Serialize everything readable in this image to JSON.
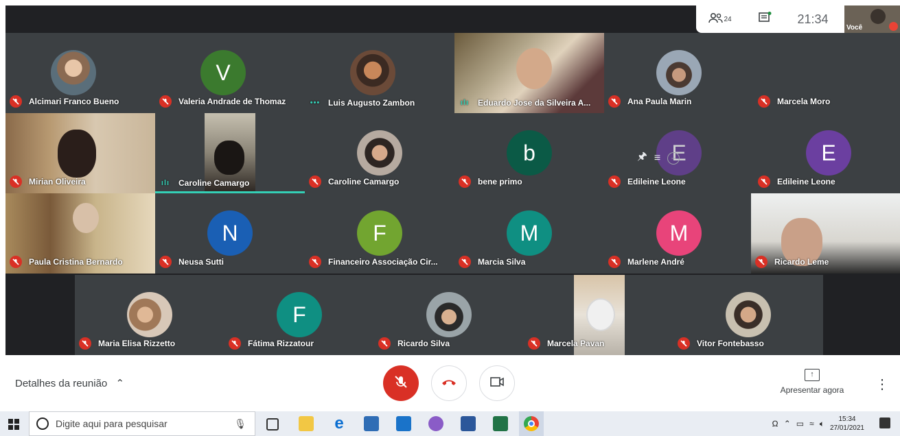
{
  "topbar": {
    "participants_count": "24",
    "time": "21:34",
    "self_label": "Você"
  },
  "row1": [
    {
      "name": "Alcimari Franco Bueno"
    },
    {
      "name": "Valeria Andrade de Thomaz",
      "initial": "V"
    },
    {
      "name": "Luis Augusto Zambon"
    },
    {
      "name": "Eduardo Jose da Silveira A..."
    },
    {
      "name": "Ana Paula Marin"
    },
    {
      "name": "Marcela Moro"
    }
  ],
  "row2": [
    {
      "name": "Mirian Oliveira"
    },
    {
      "name": "Caroline Camargo"
    },
    {
      "name": "Caroline Camargo"
    },
    {
      "name": "bene primo",
      "initial": "b"
    },
    {
      "name": "Edileine Leone",
      "initial": "E"
    },
    {
      "name": "Edileine Leone",
      "initial": "E"
    }
  ],
  "row3": [
    {
      "name": "Paula Cristina Bernardo"
    },
    {
      "name": "Neusa Sutti",
      "initial": "N"
    },
    {
      "name": "Financeiro Associação Cir...",
      "initial": "F"
    },
    {
      "name": "Marcia Silva",
      "initial": "M"
    },
    {
      "name": "Marlene André",
      "initial": "M"
    },
    {
      "name": "Ricardo Leme"
    }
  ],
  "row4": [
    {
      "name": "Maria Elisa Rizzetto"
    },
    {
      "name": "Fátima Rizzatour",
      "initial": "F"
    },
    {
      "name": "Ricardo Silva"
    },
    {
      "name": "Marcela Pavan"
    },
    {
      "name": "Vitor Fontebasso"
    }
  ],
  "controls": {
    "details": "Detalhes da reunião",
    "present": "Apresentar agora"
  },
  "taskbar": {
    "search_placeholder": "Digite aqui para pesquisar",
    "time": "15:34",
    "date": "27/01/2021"
  },
  "colors": {
    "meet_bg": "#202124",
    "tile_bg": "#3c4043",
    "mic_off": "#d93025",
    "speaking": "#34d0b6"
  }
}
